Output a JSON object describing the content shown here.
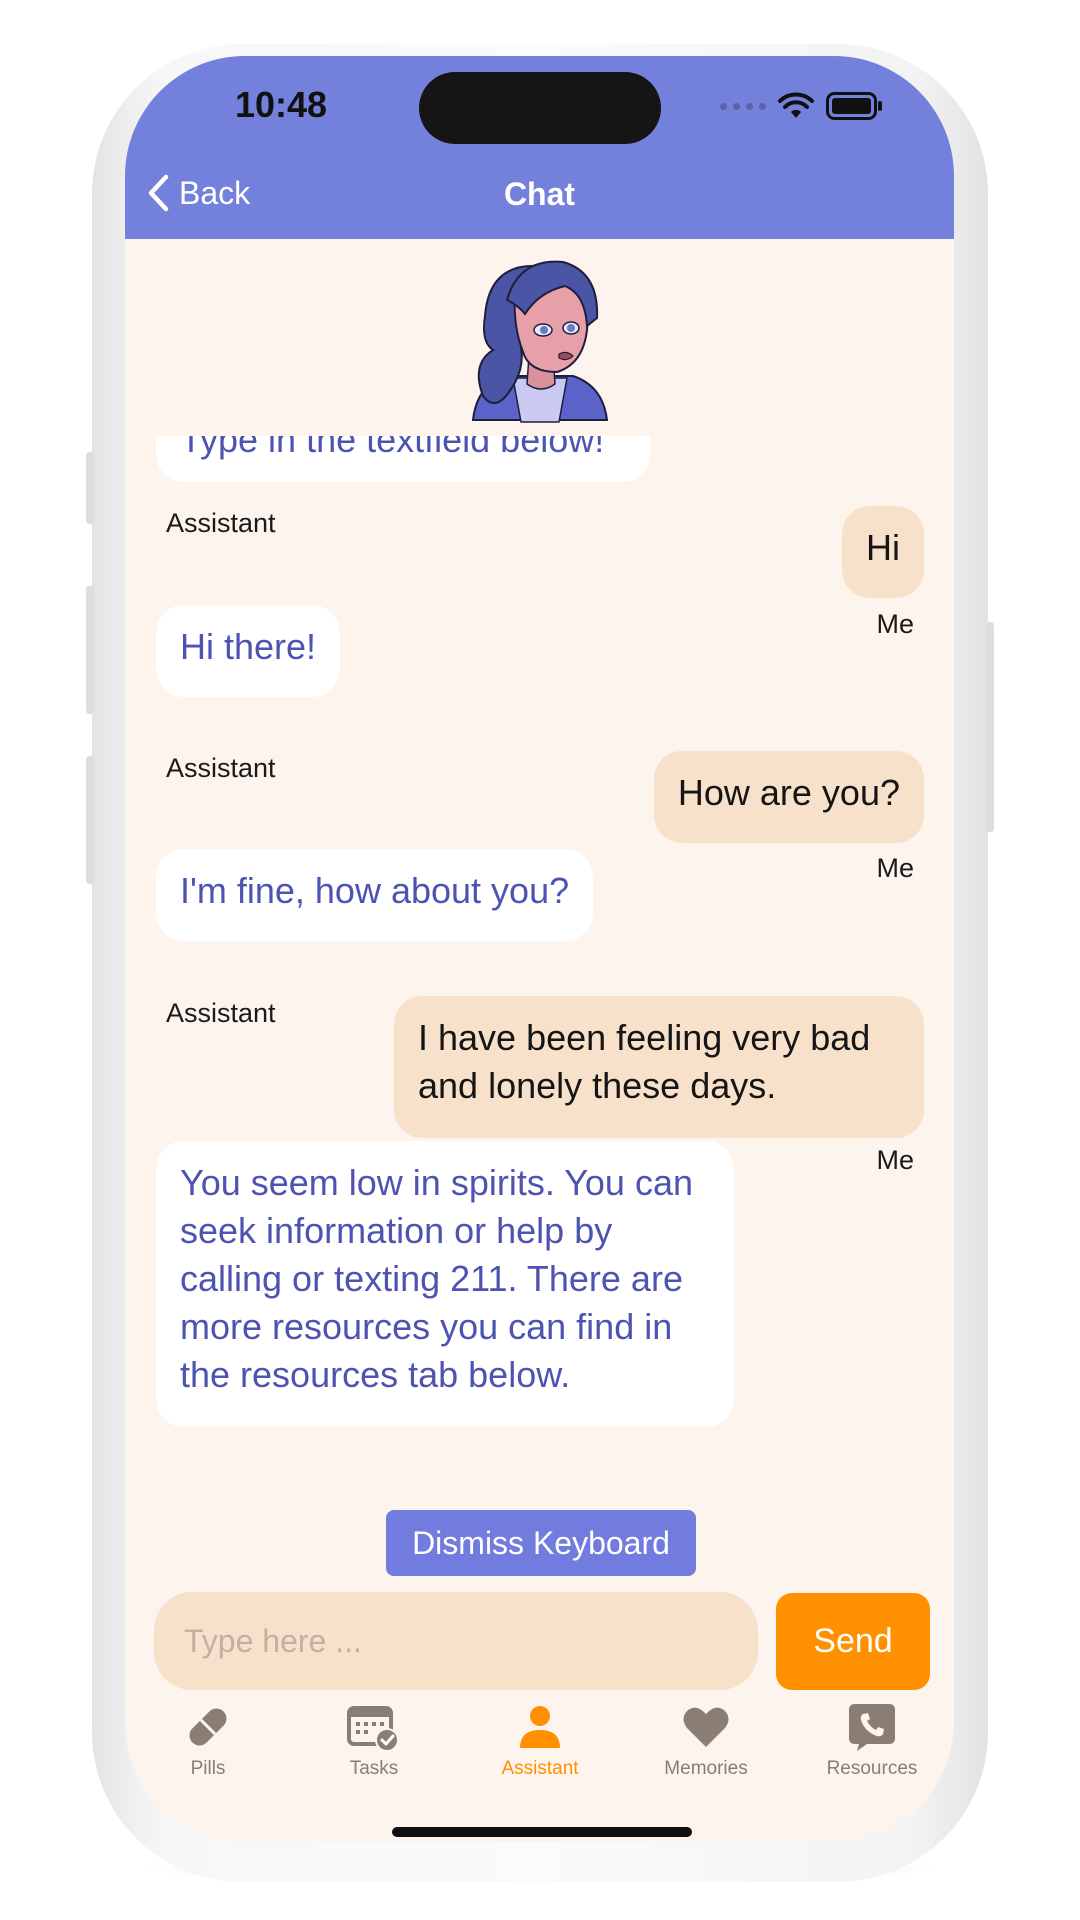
{
  "status_bar": {
    "time": "10:48"
  },
  "header": {
    "back_label": "Back",
    "title": "Chat"
  },
  "messages": [
    {
      "role": "assistant",
      "text": "Type in the textfield below!"
    },
    {
      "role": "me",
      "text": "Hi",
      "sender": "Assistant"
    },
    {
      "role": "assistant",
      "text": "Hi there!",
      "sender": "Me"
    },
    {
      "role": "me",
      "text": "How are you?",
      "sender": "Assistant"
    },
    {
      "role": "assistant",
      "text": "I'm fine, how about you?",
      "sender": "Me"
    },
    {
      "role": "me",
      "text": "I have been feeling very bad and lonely these days.",
      "sender": "Assistant"
    },
    {
      "role": "assistant",
      "text": "You seem low in spirits. You can seek information or help by calling or texting 211. There are more resources you can find in the resources tab below.",
      "sender": "Me"
    }
  ],
  "composer": {
    "dismiss_label": "Dismiss Keyboard",
    "placeholder": "Type here ...",
    "send_label": "Send"
  },
  "tabs": [
    {
      "label": "Pills",
      "icon": "pill-icon"
    },
    {
      "label": "Tasks",
      "icon": "calendar-check-icon"
    },
    {
      "label": "Assistant",
      "icon": "person-icon",
      "active": true
    },
    {
      "label": "Memories",
      "icon": "heart-icon"
    },
    {
      "label": "Resources",
      "icon": "phone-bubble-icon"
    }
  ],
  "colors": {
    "header": "#7481dc",
    "background": "#fdf4ed",
    "assistant_text": "#4d53b1",
    "me_bubble": "#f8e1cb",
    "accent": "#ff9100",
    "tab_inactive": "#8a7e74"
  }
}
